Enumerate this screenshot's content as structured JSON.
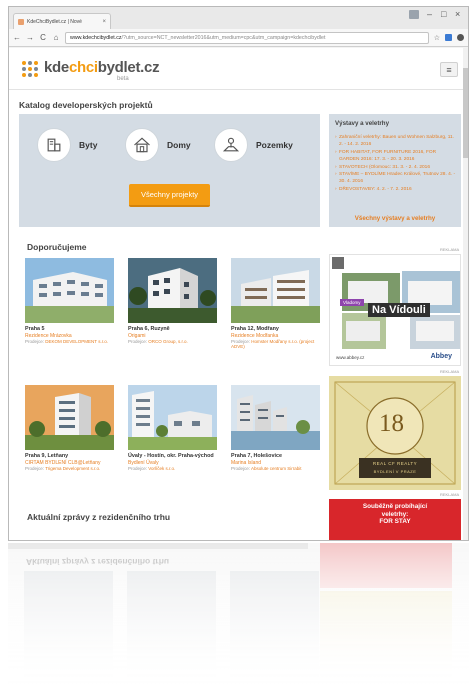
{
  "browser": {
    "tab_title": "KdeChciBydlet.cz | Nové",
    "tab_close": "×",
    "url_host": "www.kdechcibydlet.cz",
    "url_path": "/?utm_source=NCT_newsletter2016&utm_medium=cpc&utm_campaign=kdechcibydlet",
    "back": "←",
    "forward": "→",
    "reload": "C",
    "home": "⌂",
    "minimize": "–",
    "maximize": "□",
    "close": "×",
    "star": "☆"
  },
  "header": {
    "logo_part1": "kde",
    "logo_part2": "chci",
    "logo_part3": "bydlet.cz",
    "beta": "beta",
    "menu": "≡"
  },
  "catalog": {
    "title": "Katalog developerských projektů",
    "categories": [
      {
        "label": "Byty"
      },
      {
        "label": "Domy"
      },
      {
        "label": "Pozemky"
      }
    ],
    "all_button": "Všechny projekty"
  },
  "exhibitions": {
    "title": "Výstavy a veletrhy",
    "items": [
      "Zahraniční veletrhy: Bauen und Wohnen Salzburg, 11. 2. - 14. 2. 2016",
      "FOR HABITAT, FOR FURNITURE 2016, FOR GARDEN 2016: 17. 3. - 20. 3. 2016",
      "STAVOTECH (Olomouc: 31. 3. - 2. 4. 2016",
      "STAVÍME – BYDLÍME Hradec Králové, Trutnov 28. 4. - 30. 4. 2016",
      "DŘEVOSTAVBY: 4. 2. - 7. 2. 2016"
    ],
    "all_link": "Všechny výstavy a veletrhy"
  },
  "recommended": {
    "title": "Doporučujeme",
    "dev_prefix": "Prodejce:",
    "cards": [
      {
        "location": "Praha 5",
        "project": "Rezidence Mrázovka",
        "developer": "DEKOM DEVELOPMENT s.r.o."
      },
      {
        "location": "Praha 6, Ruzyně",
        "project": "Origami",
        "developer": "ORCO Group, s.r.o."
      },
      {
        "location": "Praha 12, Modřany",
        "project": "Rezidence Modřanka",
        "developer": "Homster Modřany s.r.o. (project ADVE)"
      },
      {
        "location": "Praha 9, Letňany",
        "project": "CIRTAM BYDLENÍ CLB@Letňany",
        "developer": "Trigema Development s.r.o."
      },
      {
        "location": "Úvaly - Hostín, okr. Praha-východ",
        "project": "Bydlení Úvaly",
        "developer": "Vorlíček s.r.o."
      },
      {
        "location": "Praha 7, Holešovice",
        "project": "Marina Island",
        "developer": "Absolute centrum Sirrabit"
      }
    ]
  },
  "news": {
    "title": "Aktuální zprávy z rezidenčního trhu"
  },
  "ads": {
    "label": "REKLAMA",
    "ad1_title": "Na Vídouli",
    "ad1_badge": "Vladomy",
    "ad1_url": "www.abbey.cz",
    "ad1_brand": "Abbey",
    "ad2_big": "18",
    "ad2_line1": "REAL CF REALTY",
    "ad2_line2": "BYDLENÍ V PRAZE",
    "ad3_line1": "Souběžně probíhající",
    "ad3_line2": "veletrhy:",
    "ad3_line3": "FOR STAY"
  },
  "colors": {
    "accent": "#f39c12",
    "panel": "#d4dce4",
    "link": "#e67e22",
    "ad_red": "#d8262b"
  }
}
